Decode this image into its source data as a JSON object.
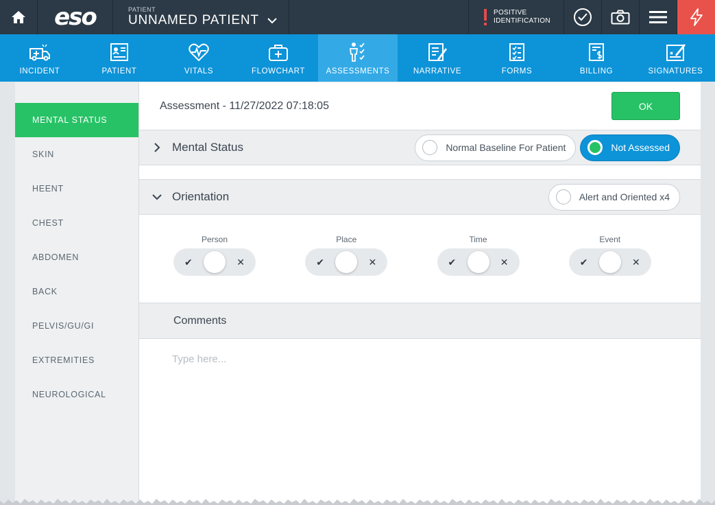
{
  "topbar": {
    "patient_label": "PATIENT",
    "patient_name": "UNNAMED PATIENT",
    "logo_text": "eso",
    "positive_id_line1": "POSITIVE",
    "positive_id_line2": "IDENTIFICATION",
    "icons": [
      "home-icon",
      "chevron-down-icon",
      "checkmark-circle-icon",
      "camera-icon",
      "menu-icon",
      "lightning-icon"
    ]
  },
  "nav": {
    "items": [
      {
        "label": "INCIDENT",
        "icon": "ambulance-icon"
      },
      {
        "label": "PATIENT",
        "icon": "id-card-icon"
      },
      {
        "label": "VITALS",
        "icon": "heart-pulse-icon"
      },
      {
        "label": "FLOWCHART",
        "icon": "medical-bag-icon"
      },
      {
        "label": "ASSESSMENTS",
        "icon": "body-check-icon"
      },
      {
        "label": "NARRATIVE",
        "icon": "narrative-icon"
      },
      {
        "label": "FORMS",
        "icon": "forms-icon"
      },
      {
        "label": "BILLING",
        "icon": "billing-icon"
      },
      {
        "label": "SIGNATURES",
        "icon": "signature-icon"
      }
    ],
    "active": "ASSESSMENTS"
  },
  "sidebar": {
    "items": [
      {
        "label": "MENTAL STATUS"
      },
      {
        "label": "SKIN"
      },
      {
        "label": "HEENT"
      },
      {
        "label": "CHEST"
      },
      {
        "label": "ABDOMEN"
      },
      {
        "label": "BACK"
      },
      {
        "label": "PELVIS/GU/GI"
      },
      {
        "label": "EXTREMITIES"
      },
      {
        "label": "NEUROLOGICAL"
      }
    ],
    "active": "MENTAL STATUS"
  },
  "main": {
    "title": "Assessment - 11/27/2022 07:18:05",
    "ok_label": "OK",
    "mental_status": {
      "title": "Mental Status",
      "options": [
        "Normal Baseline For Patient",
        "Not Assessed"
      ],
      "selected": "Not Assessed"
    },
    "orientation": {
      "title": "Orientation",
      "option": "Alert and Oriented x4",
      "toggles": [
        {
          "label": "Person"
        },
        {
          "label": "Place"
        },
        {
          "label": "Time"
        },
        {
          "label": "Event"
        }
      ],
      "yes_mark": "✔",
      "no_mark": "✕"
    },
    "comments": {
      "title": "Comments",
      "placeholder": "Type here...",
      "value": ""
    }
  },
  "colors": {
    "topbar": "#2c3a47",
    "nav": "#0d93d8",
    "nav_active": "#33a9e6",
    "green": "#27c266",
    "alert_red": "#e8524a"
  }
}
